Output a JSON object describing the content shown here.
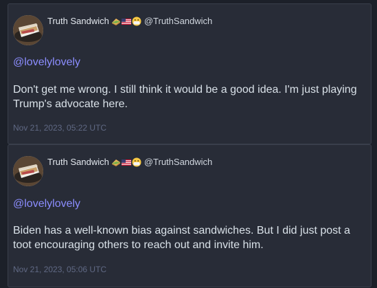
{
  "posts": [
    {
      "display_name": "Truth Sandwich",
      "emoji_icons": [
        "sandwich-icon",
        "us-flag-icon",
        "face-mask-icon"
      ],
      "handle": "@TruthSandwich",
      "mention": "@lovelylovely",
      "content": "Don't get me wrong. I still think it would be a good idea. I'm just playing Trump's advocate here.",
      "timestamp": "Nov 21, 2023, 05:22 UTC"
    },
    {
      "display_name": "Truth Sandwich",
      "emoji_icons": [
        "sandwich-icon",
        "us-flag-icon",
        "face-mask-icon"
      ],
      "handle": "@TruthSandwich",
      "mention": "@lovelylovely",
      "content": "Biden has a well-known bias against sandwiches. But I did just post a toot encouraging others to reach out and invite him.",
      "timestamp": "Nov 21, 2023, 05:06 UTC"
    }
  ],
  "colors": {
    "background": "#1c2029",
    "card": "#282c37",
    "mention": "#8c8dff",
    "text": "#d9e1e8",
    "timestamp": "#606984"
  }
}
